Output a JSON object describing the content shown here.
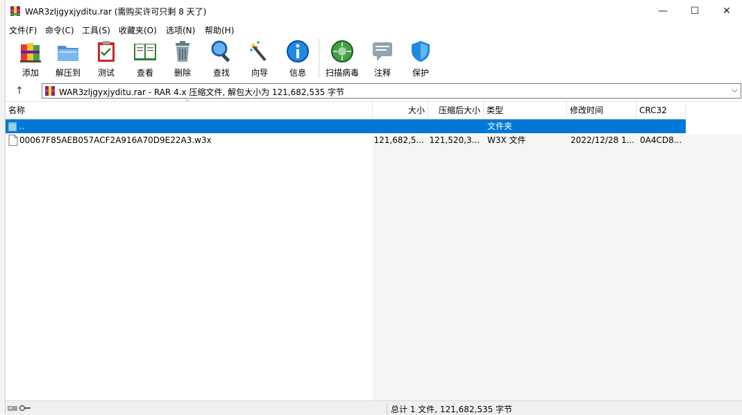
{
  "window": {
    "title": "WAR3zljgyxjyditu.rar (需购买许可只剩 8 天了)",
    "minimize_glyph": "—",
    "maximize_glyph": "☐",
    "close_glyph": "✕"
  },
  "menu": [
    {
      "label": "文件(F)"
    },
    {
      "label": "命令(C)"
    },
    {
      "label": "工具(S)"
    },
    {
      "label": "收藏夹(O)"
    },
    {
      "label": "选项(N)"
    },
    {
      "label": "帮助(H)"
    }
  ],
  "toolbar": [
    {
      "label": "添加",
      "icon": "books-add-icon"
    },
    {
      "label": "解压到",
      "icon": "folder-extract-icon"
    },
    {
      "label": "测试",
      "icon": "clipboard-check-icon"
    },
    {
      "label": "查看",
      "icon": "open-book-icon"
    },
    {
      "label": "删除",
      "icon": "trash-can-icon"
    },
    {
      "label": "查找",
      "icon": "magnifier-icon"
    },
    {
      "label": "向导",
      "icon": "magic-wand-icon"
    },
    {
      "label": "信息",
      "icon": "info-icon"
    },
    {
      "label": "扫描病毒",
      "icon": "virus-scan-icon"
    },
    {
      "label": "注释",
      "icon": "comment-icon"
    },
    {
      "label": "保护",
      "icon": "shield-icon"
    }
  ],
  "address": {
    "up_glyph": "↑",
    "text": "WAR3zljgyxjyditu.rar - RAR 4.x 压缩文件, 解包大小为 121,682,535 字节",
    "dropdown_glyph": "⌵"
  },
  "columns": {
    "name": "名称",
    "size": "大小",
    "packed": "压缩后大小",
    "type": "类型",
    "modified": "修改时间",
    "crc": "CRC32"
  },
  "files": [
    {
      "name": "..",
      "size": "",
      "packed": "",
      "type": "文件夹",
      "modified": "",
      "crc": "",
      "kind": "folder",
      "selected": true
    },
    {
      "name": "00067F85AEB057ACF2A916A70D9E22A3.w3x",
      "size": "121,682,5...",
      "packed": "121,520,3...",
      "type": "W3X 文件",
      "modified": "2022/12/28 1...",
      "crc": "0A4CD8...",
      "kind": "file",
      "selected": false
    }
  ],
  "status": {
    "text": "总计 1 文件, 121,682,535 字节"
  },
  "colors": {
    "selection": "#0078d7",
    "accent_blue": "#1a73e8"
  }
}
